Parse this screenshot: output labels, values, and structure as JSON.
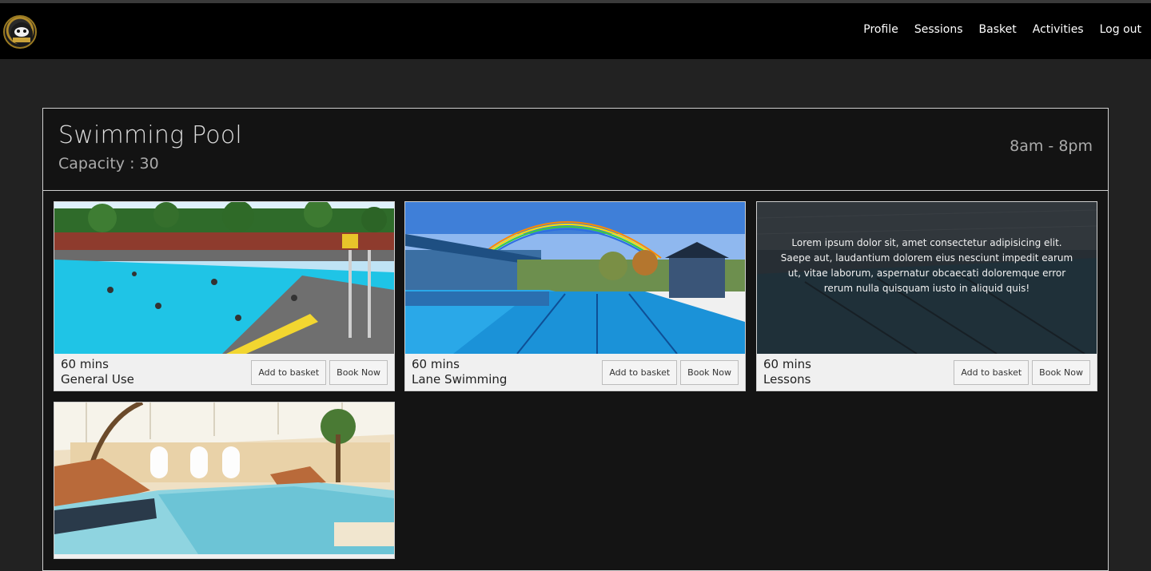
{
  "nav": {
    "links": [
      "Profile",
      "Sessions",
      "Basket",
      "Activities",
      "Log out"
    ]
  },
  "facility": {
    "title": "Swimming Pool",
    "capacity": "Capacity : 30",
    "hours": "8am - 8pm"
  },
  "cards": [
    {
      "duration": "60 mins",
      "name": "General Use",
      "add_label": "Add to basket",
      "book_label": "Book Now"
    },
    {
      "duration": "60 mins",
      "name": "Lane Swimming",
      "add_label": "Add to basket",
      "book_label": "Book Now"
    },
    {
      "duration": "60 mins",
      "name": "Lessons",
      "add_label": "Add to basket",
      "book_label": "Book Now",
      "overlay": "Lorem ipsum dolor sit, amet consectetur adipisicing elit. Saepe aut, laudantium dolorem eius nesciunt impedit earum ut, vitae laborum, aspernatur obcaecati doloremque error rerum nulla quisquam iusto in aliquid quis!"
    },
    {
      "duration": "",
      "name": "",
      "add_label": "",
      "book_label": ""
    }
  ],
  "colors": {
    "navbar": "#000000",
    "page_bg": "#222222",
    "panel_bg": "#141414",
    "card_bg": "#f0f0f0",
    "pool_water": "#1fc4e6"
  }
}
